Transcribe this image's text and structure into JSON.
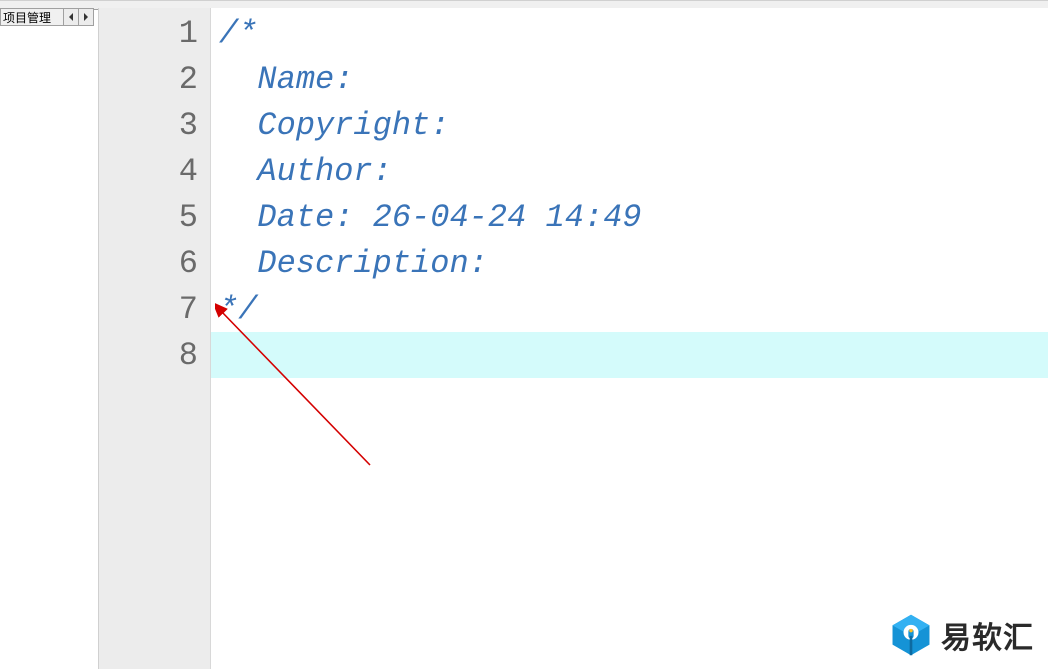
{
  "side_panel": {
    "tab_label": "项目管理"
  },
  "editor": {
    "current_line": 8,
    "lines": [
      {
        "num": 1,
        "text": "/*"
      },
      {
        "num": 2,
        "text": "  Name:"
      },
      {
        "num": 3,
        "text": "  Copyright:"
      },
      {
        "num": 4,
        "text": "  Author:"
      },
      {
        "num": 5,
        "text": "  Date: 26-04-24 14:49"
      },
      {
        "num": 6,
        "text": "  Description:"
      },
      {
        "num": 7,
        "text": "*/"
      },
      {
        "num": 8,
        "text": ""
      }
    ]
  },
  "watermark": {
    "text": "易软汇"
  }
}
